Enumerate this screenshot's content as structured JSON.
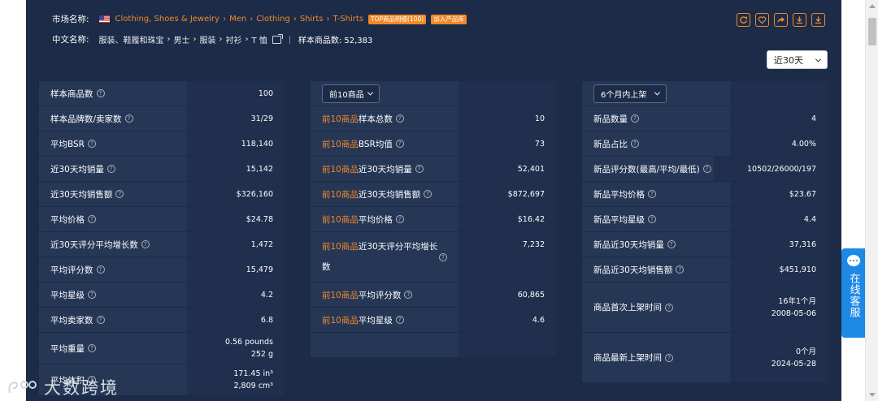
{
  "header": {
    "market_label": "市场名称:",
    "breadcrumb_en": [
      "Clothing, Shoes & Jewelry",
      "Men",
      "Clothing",
      "Shirts",
      "T-Shirts"
    ],
    "tag_top": "TOP商品明细(100)",
    "tag_add": "加入产品库",
    "cn_label": "中文名称:",
    "breadcrumb_cn": [
      "服装、鞋履和珠宝",
      "男士",
      "服装",
      "衬衫",
      "T 恤"
    ],
    "sample_count": "样本商品数: 52,383",
    "period_select": "近30天"
  },
  "col1": {
    "rows": [
      {
        "label": "样本商品数",
        "value": "100"
      },
      {
        "label": "样本品牌数/卖家数",
        "value": "31/29"
      },
      {
        "label": "平均BSR",
        "value": "118,140"
      },
      {
        "label": "近30天均销量",
        "value": "15,142"
      },
      {
        "label": "近30天均销售额",
        "value": "$326,160"
      },
      {
        "label": "平均价格",
        "value": "$24.78"
      },
      {
        "label": "近30天评分平均增长数",
        "value": "1,472"
      },
      {
        "label": "平均评分数",
        "value": "15,479"
      },
      {
        "label": "平均星级",
        "value": "4.2"
      },
      {
        "label": "平均卖家数",
        "value": "6.8"
      },
      {
        "label": "平均重量",
        "value": "0.56 pounds",
        "value2": "252 g"
      },
      {
        "label": "平均体积",
        "value": "171.45 in³",
        "value2": "2,809 cm³"
      }
    ]
  },
  "col2": {
    "select": "前10商品",
    "prefix": "前10商品",
    "rows": [
      {
        "label": "样本总数",
        "value": "10"
      },
      {
        "label": "BSR均值",
        "value": "73"
      },
      {
        "label": "近30天均销量",
        "value": "52,401"
      },
      {
        "label": "近30天均销售额",
        "value": "$872,697"
      },
      {
        "label": "平均价格",
        "value": "$16.42"
      },
      {
        "label": "近30天评分平均增长",
        "label2": "数",
        "value": "7,232"
      },
      {
        "label": "平均评分数",
        "value": "60,865"
      },
      {
        "label": "平均星级",
        "value": "4.6"
      }
    ]
  },
  "col3": {
    "select": "6个月内上架",
    "rows": [
      {
        "label": "新品数量",
        "value": "4"
      },
      {
        "label": "新品占比",
        "value": "4.00%"
      },
      {
        "label": "新品评分数(最高/平均/最低)",
        "value": "10502/26000/197"
      },
      {
        "label": "新品平均价格",
        "value": "$23.67"
      },
      {
        "label": "新品平均星级",
        "value": "4.4"
      },
      {
        "label": "新品近30天均销量",
        "value": "37,316"
      },
      {
        "label": "新品近30天均销售额",
        "value": "$451,910"
      },
      {
        "label": "商品首次上架时间",
        "value": "16年1个月",
        "value2": "2008-05-06"
      },
      {
        "label": "商品最新上架时间",
        "value": "0个月",
        "value2": "2024-05-28"
      }
    ]
  },
  "chat": {
    "label": "在线客服"
  },
  "watermark": {
    "text": "大数跨境"
  },
  "colors": {
    "accent": "#f08a2a",
    "panel": "#1c2b47",
    "chat": "#1e88e5"
  }
}
